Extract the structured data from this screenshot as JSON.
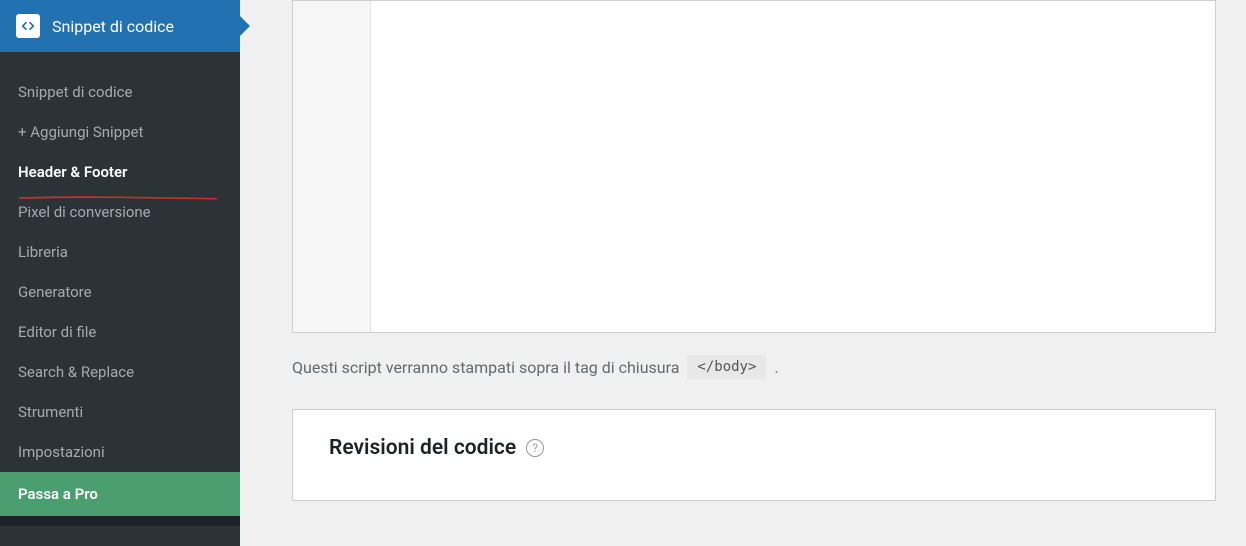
{
  "sidebar": {
    "header": {
      "title": "Snippet di codice"
    },
    "items": [
      {
        "label": "Snippet di codice",
        "active": false
      },
      {
        "label": "+ Aggiungi Snippet",
        "active": false
      },
      {
        "label": "Header & Footer",
        "active": true
      },
      {
        "label": "Pixel di conversione",
        "active": false
      },
      {
        "label": "Libreria",
        "active": false
      },
      {
        "label": "Generatore",
        "active": false
      },
      {
        "label": "Editor di file",
        "active": false
      },
      {
        "label": "Search & Replace",
        "active": false
      },
      {
        "label": "Strumenti",
        "active": false
      },
      {
        "label": "Impostazioni",
        "active": false
      }
    ],
    "pro_label": "Passa a Pro"
  },
  "main": {
    "description_text": "Questi script verranno stampati sopra il tag di chiusura ",
    "description_code": "</body>",
    "description_suffix": ".",
    "revisions_title": "Revisioni del codice",
    "help_symbol": "?"
  }
}
